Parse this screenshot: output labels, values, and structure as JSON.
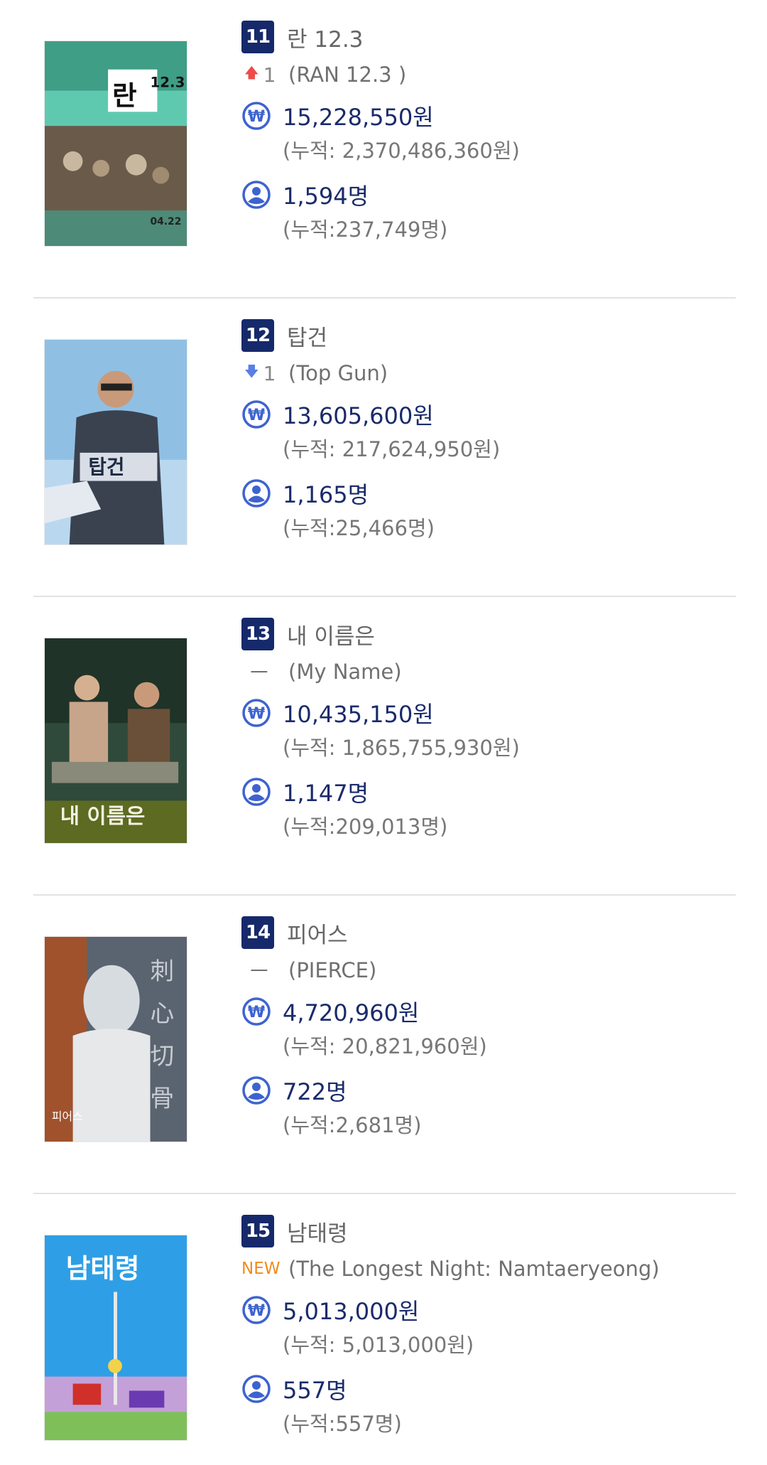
{
  "movies": [
    {
      "rank": "11",
      "title": "란 12.3",
      "change": {
        "type": "up",
        "value": "1"
      },
      "eng_title": "(RAN 12.3 )",
      "sales": "15,228,550원",
      "sales_cum": "(누적: 2,370,486,360원)",
      "audience": "1,594명",
      "audience_cum": "(누적:237,749명)",
      "poster_text": "란 12.3"
    },
    {
      "rank": "12",
      "title": "탑건",
      "change": {
        "type": "down",
        "value": "1"
      },
      "eng_title": "(Top Gun)",
      "sales": "13,605,600원",
      "sales_cum": "(누적: 217,624,950원)",
      "audience": "1,165명",
      "audience_cum": "(누적:25,466명)",
      "poster_text": "탑건"
    },
    {
      "rank": "13",
      "title": "내 이름은",
      "change": {
        "type": "same",
        "value": "ㅡ"
      },
      "eng_title": "(My Name)",
      "sales": "10,435,150원",
      "sales_cum": "(누적: 1,865,755,930원)",
      "audience": "1,147명",
      "audience_cum": "(누적:209,013명)",
      "poster_text": "내 이름은"
    },
    {
      "rank": "14",
      "title": "피어스",
      "change": {
        "type": "same",
        "value": "ㅡ"
      },
      "eng_title": "(PIERCE)",
      "sales": "4,720,960원",
      "sales_cum": "(누적: 20,821,960원)",
      "audience": "722명",
      "audience_cum": "(누적:2,681명)",
      "poster_text": "刺心切骨"
    },
    {
      "rank": "15",
      "title": "남태령",
      "change": {
        "type": "new",
        "value": "NEW"
      },
      "eng_title": "(The Longest Night: Namtaeryeong)",
      "sales": "5,013,000원",
      "sales_cum": "(누적: 5,013,000원)",
      "audience": "557명",
      "audience_cum": "(누적:557명)",
      "poster_text": "남태령"
    }
  ],
  "colors": {
    "badge_bg": "#16296b",
    "accent_blue": "#3e63cf",
    "up": "#ee4a4a",
    "down": "#5a7ee6",
    "new": "#f08c1a"
  },
  "icons": {
    "sales": "won-coin-icon",
    "audience": "person-circle-icon",
    "up": "arrow-up-icon",
    "down": "arrow-down-icon"
  }
}
